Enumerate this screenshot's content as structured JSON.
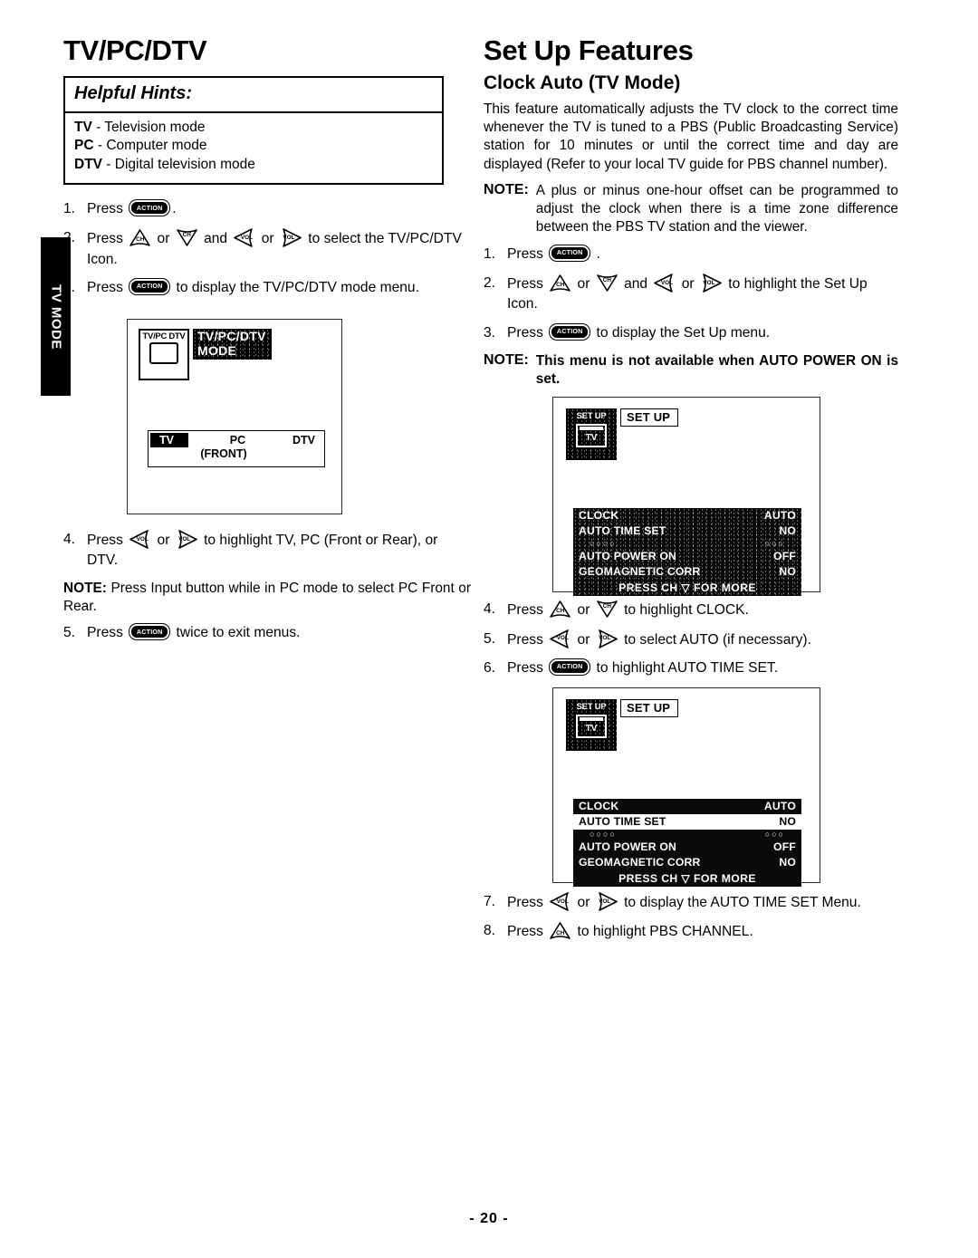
{
  "side_tab": {
    "label": "TV MODE"
  },
  "left": {
    "title": "TV/PC/DTV",
    "hints": {
      "heading": "Helpful Hints:",
      "lines": [
        {
          "term": "TV",
          "desc": " - Television mode"
        },
        {
          "term": "PC",
          "desc": " - Computer mode"
        },
        {
          "term": "DTV",
          "desc": " - Digital television mode"
        }
      ]
    },
    "steps": [
      {
        "num": "1.",
        "pre": "Press ",
        "post": "."
      },
      {
        "num": "2.",
        "pre": "Press ",
        "mid1": " or ",
        "mid2": " and ",
        "mid3": " or ",
        "post": " to select the TV/PC/DTV Icon."
      },
      {
        "num": "3.",
        "pre": "Press ",
        "post": " to display the TV/PC/DTV mode menu."
      },
      {
        "num": "4.",
        "pre": "Press ",
        "mid1": " or ",
        "post": " to highlight TV, PC (Front or Rear), or DTV."
      },
      {
        "num": "5.",
        "pre": "Press ",
        "post": " twice to exit menus."
      }
    ],
    "note": {
      "lead": "NOTE:",
      "body": " Press Input button while in PC mode to select PC Front or Rear."
    },
    "osd": {
      "icon_label": "TV/PC DTV",
      "banner_line1": "TV/PC/DTV",
      "banner_line2": "MODE",
      "options": [
        "TV",
        "PC",
        "DTV"
      ],
      "sub_option": "(FRONT)"
    }
  },
  "right": {
    "title": "Set Up Features",
    "subtitle": "Clock Auto (TV Mode)",
    "paragraph": "This feature automatically adjusts the TV clock to the correct time whenever the TV is tuned to a PBS (Public Broadcasting Service) station for 10 minutes or until the correct time and day are displayed (Refer to your local TV guide for PBS channel number).",
    "note1": {
      "lead": "NOTE:",
      "body": "A plus or minus one-hour offset can be programmed to adjust the clock when there is a time zone difference between the PBS TV station and the viewer."
    },
    "note2": {
      "lead": "NOTE:",
      "body": "This menu is not available when AUTO POWER ON is set."
    },
    "steps_a": [
      {
        "num": "1.",
        "pre": "Press ",
        "post": " ."
      },
      {
        "num": "2.",
        "pre": "Press ",
        "mid1": " or ",
        "mid2": " and ",
        "mid3": " or ",
        "post": " to highlight the Set Up Icon."
      },
      {
        "num": "3.",
        "pre": "Press ",
        "post": " to display the Set Up menu."
      }
    ],
    "steps_b": [
      {
        "num": "4.",
        "pre": "Press ",
        "mid1": " or ",
        "post": " to highlight CLOCK."
      },
      {
        "num": "5.",
        "pre": "Press ",
        "mid1": " or ",
        "post": " to select AUTO (if necessary)."
      },
      {
        "num": "6.",
        "pre": "Press ",
        "post": " to highlight AUTO TIME SET."
      }
    ],
    "steps_c": [
      {
        "num": "7.",
        "pre": "Press ",
        "mid1": " or ",
        "post": " to display the AUTO TIME SET Menu."
      },
      {
        "num": "8.",
        "pre": "Press ",
        "post": " to highlight PBS CHANNEL."
      }
    ],
    "osd1": {
      "icon_label": "SET UP",
      "icon_tv": "TV",
      "banner": "SET UP",
      "rows": [
        {
          "label": "CLOCK",
          "value": "AUTO"
        },
        {
          "label": "AUTO TIME SET",
          "value": "NO"
        },
        {
          "label": "AUTO POWER ON",
          "value": "OFF"
        },
        {
          "label": "GEOMAGNETIC CORR",
          "value": "NO"
        }
      ],
      "footer": "PRESS CH ▽ FOR MORE"
    },
    "osd2": {
      "icon_label": "SET UP",
      "icon_tv": "TV",
      "banner": "SET UP",
      "rows": [
        {
          "label": "CLOCK",
          "value": "AUTO",
          "selected": false
        },
        {
          "label": "AUTO TIME SET",
          "value": "NO",
          "selected": true
        },
        {
          "label": "AUTO POWER ON",
          "value": "OFF",
          "selected": false
        },
        {
          "label": "GEOMAGNETIC CORR",
          "value": "NO",
          "selected": false
        }
      ],
      "footer": "PRESS CH ▽ FOR MORE"
    }
  },
  "keys": {
    "action": "ACTION",
    "ch": "CH",
    "vol": "VOL"
  },
  "footer": {
    "page_number": "- 20 -"
  }
}
